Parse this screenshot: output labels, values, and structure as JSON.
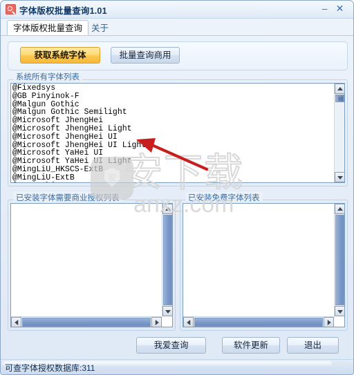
{
  "window": {
    "title": "字体版权批量查询1.01",
    "app_icon": "search-icon",
    "minimize_label": "–",
    "close_label": "✕",
    "accent_color": "#e8695f",
    "title_color": "#113a68"
  },
  "tabs": [
    {
      "label": "字体版权批量查询",
      "active": true
    },
    {
      "label": "关于",
      "active": false
    }
  ],
  "toolbar": {
    "get_fonts_label": "获取系统字体",
    "get_fonts_color": "#f6b93a",
    "batch_query_label": "批量查询商用",
    "batch_query_color": "#cbdaec"
  },
  "groups": {
    "all_fonts": {
      "label": "系统所有字体列表",
      "items": [
        "@Fixedsys",
        "@GB Pinyinok-F",
        "@Malgun Gothic",
        "@Malgun Gothic Semilight",
        "@Microsoft JhengHei",
        "@Microsoft JhengHei Light",
        "@Microsoft JhengHei UI",
        "@Microsoft JhengHei UI Light",
        "@Microsoft YaHei UI",
        "@Microsoft YaHei UI Light",
        "@MingLiU_HKSCS-ExtB",
        "@MingLiU-ExtB",
        "@MS Gothic"
      ]
    },
    "paid_fonts": {
      "label": "已安装字体需要商业授权列表",
      "items": []
    },
    "free_fonts": {
      "label": "已安装免费字体列表",
      "items": []
    }
  },
  "bottom_buttons": [
    {
      "label": "我爱查询"
    },
    {
      "label": "软件更新"
    },
    {
      "label": "退出"
    }
  ],
  "statusbar": {
    "text": "可查字体授权数据库:311",
    "database_count": 311
  },
  "watermark": {
    "chinese": "安下载",
    "url": "anxz.com",
    "color": "#d6d6d6"
  },
  "annotation": {
    "arrow_color": "#c81e1e",
    "points_to": "系统所有字体列表"
  }
}
